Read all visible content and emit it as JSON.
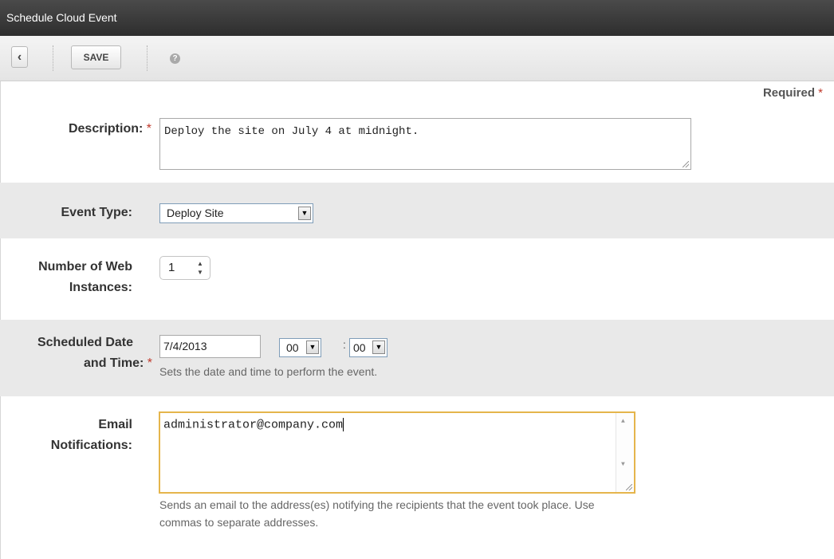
{
  "window": {
    "title": "Schedule Cloud Event"
  },
  "toolbar": {
    "back_icon": "chevron-left-icon",
    "save_label": "SAVE",
    "help_icon": "help-icon"
  },
  "required_note": {
    "text": "Required",
    "marker": "*"
  },
  "form": {
    "description": {
      "label": "Description:",
      "required_marker": "*",
      "value": "Deploy the site on July 4 at midnight."
    },
    "event_type": {
      "label": "Event Type:",
      "selected": "Deploy Site"
    },
    "web_instances": {
      "label_line1": "Number of Web",
      "label_line2": "Instances:",
      "value": "1"
    },
    "scheduled": {
      "label_line1": "Scheduled Date",
      "label_line2": "and Time:",
      "required_marker": "*",
      "date": "7/4/2013",
      "hour": "00",
      "minute": "00",
      "separator": ":",
      "help": "Sets the date and time to perform the event."
    },
    "email": {
      "label_line1": "Email",
      "label_line2": "Notifications:",
      "value": "administrator@company.com",
      "help_line1": "Sends an email to the address(es) notifying the recipients that the event took place. Use",
      "help_line2": "commas to separate addresses."
    }
  },
  "colors": {
    "titlebar": "#2e2e2e",
    "required": "#c0392b",
    "focus_border": "#e5b54c",
    "row_alt": "#e9e9e9"
  }
}
